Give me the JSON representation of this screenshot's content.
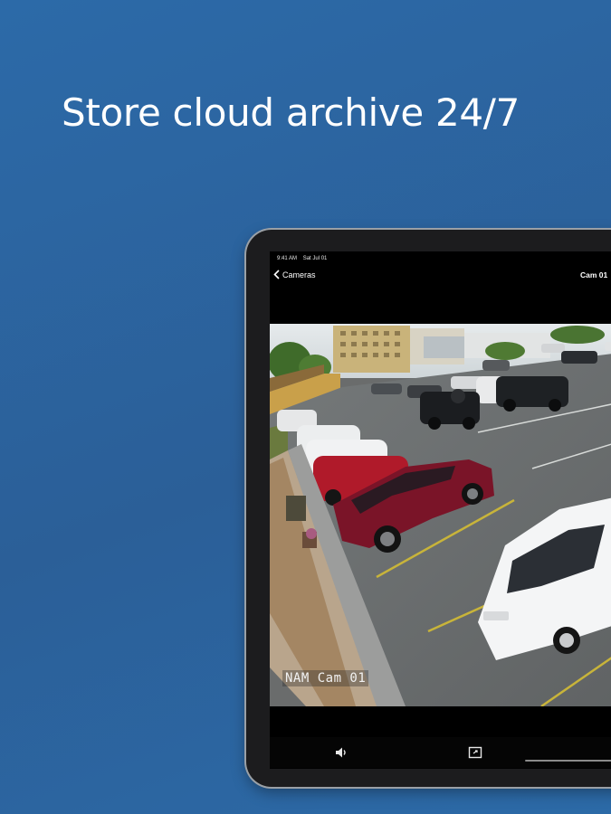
{
  "headline": "Store cloud archive 24/7",
  "device": {
    "status": {
      "time": "9:41 AM",
      "date": "Sat Jul 01"
    },
    "nav": {
      "back_label": "Cameras",
      "title": "Cam 01"
    },
    "video": {
      "overlay_label": "NAM Cam 01"
    },
    "controls": {
      "icons": [
        "volume-icon",
        "fullscreen-icon",
        "play-icon"
      ]
    }
  },
  "colors": {
    "background": "#2b64a0",
    "text": "#ffffff",
    "screen": "#000000"
  }
}
